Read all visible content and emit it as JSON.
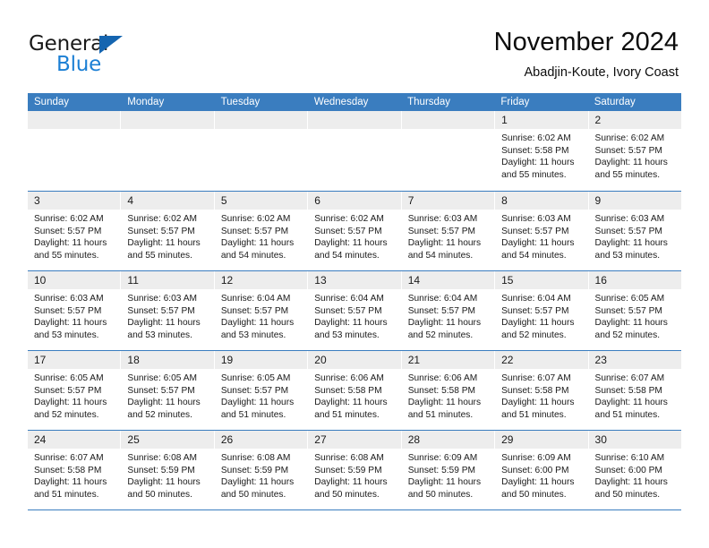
{
  "brand": {
    "name_part1": "General",
    "name_part2": "Blue",
    "triangle_icon": "triangle-icon",
    "color_dark": "#1a1a1a",
    "color_blue": "#1b7fd4",
    "color_triangle": "#1565b0"
  },
  "header": {
    "title": "November 2024",
    "subtitle": "Abadjin-Koute, Ivory Coast"
  },
  "theme": {
    "header_bar": "#3a7dbf",
    "day_strip": "#ededed",
    "text": "#1a1a1a"
  },
  "weekdays": [
    "Sunday",
    "Monday",
    "Tuesday",
    "Wednesday",
    "Thursday",
    "Friday",
    "Saturday"
  ],
  "weeks": [
    [
      {
        "day": "",
        "empty": true
      },
      {
        "day": "",
        "empty": true
      },
      {
        "day": "",
        "empty": true
      },
      {
        "day": "",
        "empty": true
      },
      {
        "day": "",
        "empty": true
      },
      {
        "day": "1",
        "sunrise": "Sunrise: 6:02 AM",
        "sunset": "Sunset: 5:58 PM",
        "daylight1": "Daylight: 11 hours",
        "daylight2": "and 55 minutes."
      },
      {
        "day": "2",
        "sunrise": "Sunrise: 6:02 AM",
        "sunset": "Sunset: 5:57 PM",
        "daylight1": "Daylight: 11 hours",
        "daylight2": "and 55 minutes."
      }
    ],
    [
      {
        "day": "3",
        "sunrise": "Sunrise: 6:02 AM",
        "sunset": "Sunset: 5:57 PM",
        "daylight1": "Daylight: 11 hours",
        "daylight2": "and 55 minutes."
      },
      {
        "day": "4",
        "sunrise": "Sunrise: 6:02 AM",
        "sunset": "Sunset: 5:57 PM",
        "daylight1": "Daylight: 11 hours",
        "daylight2": "and 55 minutes."
      },
      {
        "day": "5",
        "sunrise": "Sunrise: 6:02 AM",
        "sunset": "Sunset: 5:57 PM",
        "daylight1": "Daylight: 11 hours",
        "daylight2": "and 54 minutes."
      },
      {
        "day": "6",
        "sunrise": "Sunrise: 6:02 AM",
        "sunset": "Sunset: 5:57 PM",
        "daylight1": "Daylight: 11 hours",
        "daylight2": "and 54 minutes."
      },
      {
        "day": "7",
        "sunrise": "Sunrise: 6:03 AM",
        "sunset": "Sunset: 5:57 PM",
        "daylight1": "Daylight: 11 hours",
        "daylight2": "and 54 minutes."
      },
      {
        "day": "8",
        "sunrise": "Sunrise: 6:03 AM",
        "sunset": "Sunset: 5:57 PM",
        "daylight1": "Daylight: 11 hours",
        "daylight2": "and 54 minutes."
      },
      {
        "day": "9",
        "sunrise": "Sunrise: 6:03 AM",
        "sunset": "Sunset: 5:57 PM",
        "daylight1": "Daylight: 11 hours",
        "daylight2": "and 53 minutes."
      }
    ],
    [
      {
        "day": "10",
        "sunrise": "Sunrise: 6:03 AM",
        "sunset": "Sunset: 5:57 PM",
        "daylight1": "Daylight: 11 hours",
        "daylight2": "and 53 minutes."
      },
      {
        "day": "11",
        "sunrise": "Sunrise: 6:03 AM",
        "sunset": "Sunset: 5:57 PM",
        "daylight1": "Daylight: 11 hours",
        "daylight2": "and 53 minutes."
      },
      {
        "day": "12",
        "sunrise": "Sunrise: 6:04 AM",
        "sunset": "Sunset: 5:57 PM",
        "daylight1": "Daylight: 11 hours",
        "daylight2": "and 53 minutes."
      },
      {
        "day": "13",
        "sunrise": "Sunrise: 6:04 AM",
        "sunset": "Sunset: 5:57 PM",
        "daylight1": "Daylight: 11 hours",
        "daylight2": "and 53 minutes."
      },
      {
        "day": "14",
        "sunrise": "Sunrise: 6:04 AM",
        "sunset": "Sunset: 5:57 PM",
        "daylight1": "Daylight: 11 hours",
        "daylight2": "and 52 minutes."
      },
      {
        "day": "15",
        "sunrise": "Sunrise: 6:04 AM",
        "sunset": "Sunset: 5:57 PM",
        "daylight1": "Daylight: 11 hours",
        "daylight2": "and 52 minutes."
      },
      {
        "day": "16",
        "sunrise": "Sunrise: 6:05 AM",
        "sunset": "Sunset: 5:57 PM",
        "daylight1": "Daylight: 11 hours",
        "daylight2": "and 52 minutes."
      }
    ],
    [
      {
        "day": "17",
        "sunrise": "Sunrise: 6:05 AM",
        "sunset": "Sunset: 5:57 PM",
        "daylight1": "Daylight: 11 hours",
        "daylight2": "and 52 minutes."
      },
      {
        "day": "18",
        "sunrise": "Sunrise: 6:05 AM",
        "sunset": "Sunset: 5:57 PM",
        "daylight1": "Daylight: 11 hours",
        "daylight2": "and 52 minutes."
      },
      {
        "day": "19",
        "sunrise": "Sunrise: 6:05 AM",
        "sunset": "Sunset: 5:57 PM",
        "daylight1": "Daylight: 11 hours",
        "daylight2": "and 51 minutes."
      },
      {
        "day": "20",
        "sunrise": "Sunrise: 6:06 AM",
        "sunset": "Sunset: 5:58 PM",
        "daylight1": "Daylight: 11 hours",
        "daylight2": "and 51 minutes."
      },
      {
        "day": "21",
        "sunrise": "Sunrise: 6:06 AM",
        "sunset": "Sunset: 5:58 PM",
        "daylight1": "Daylight: 11 hours",
        "daylight2": "and 51 minutes."
      },
      {
        "day": "22",
        "sunrise": "Sunrise: 6:07 AM",
        "sunset": "Sunset: 5:58 PM",
        "daylight1": "Daylight: 11 hours",
        "daylight2": "and 51 minutes."
      },
      {
        "day": "23",
        "sunrise": "Sunrise: 6:07 AM",
        "sunset": "Sunset: 5:58 PM",
        "daylight1": "Daylight: 11 hours",
        "daylight2": "and 51 minutes."
      }
    ],
    [
      {
        "day": "24",
        "sunrise": "Sunrise: 6:07 AM",
        "sunset": "Sunset: 5:58 PM",
        "daylight1": "Daylight: 11 hours",
        "daylight2": "and 51 minutes."
      },
      {
        "day": "25",
        "sunrise": "Sunrise: 6:08 AM",
        "sunset": "Sunset: 5:59 PM",
        "daylight1": "Daylight: 11 hours",
        "daylight2": "and 50 minutes."
      },
      {
        "day": "26",
        "sunrise": "Sunrise: 6:08 AM",
        "sunset": "Sunset: 5:59 PM",
        "daylight1": "Daylight: 11 hours",
        "daylight2": "and 50 minutes."
      },
      {
        "day": "27",
        "sunrise": "Sunrise: 6:08 AM",
        "sunset": "Sunset: 5:59 PM",
        "daylight1": "Daylight: 11 hours",
        "daylight2": "and 50 minutes."
      },
      {
        "day": "28",
        "sunrise": "Sunrise: 6:09 AM",
        "sunset": "Sunset: 5:59 PM",
        "daylight1": "Daylight: 11 hours",
        "daylight2": "and 50 minutes."
      },
      {
        "day": "29",
        "sunrise": "Sunrise: 6:09 AM",
        "sunset": "Sunset: 6:00 PM",
        "daylight1": "Daylight: 11 hours",
        "daylight2": "and 50 minutes."
      },
      {
        "day": "30",
        "sunrise": "Sunrise: 6:10 AM",
        "sunset": "Sunset: 6:00 PM",
        "daylight1": "Daylight: 11 hours",
        "daylight2": "and 50 minutes."
      }
    ]
  ]
}
